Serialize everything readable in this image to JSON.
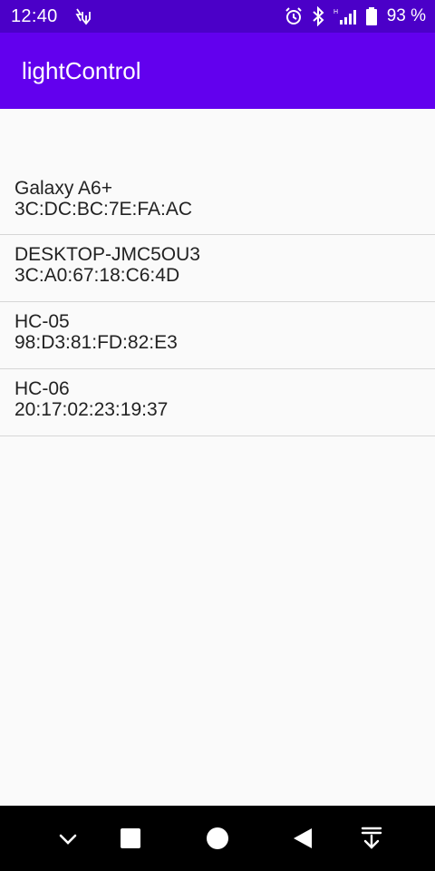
{
  "status_bar": {
    "time": "12:40",
    "battery": "93 %",
    "icons": [
      "usb-debug-icon",
      "alarm-icon",
      "bluetooth-icon",
      "signal-icon",
      "battery-icon"
    ]
  },
  "app_bar": {
    "title": "lightControl"
  },
  "devices": [
    {
      "name": "Galaxy A6+",
      "mac": "3C:DC:BC:7E:FA:AC"
    },
    {
      "name": "DESKTOP-JMC5OU3",
      "mac": "3C:A0:67:18:C6:4D"
    },
    {
      "name": "HC-05",
      "mac": "98:D3:81:FD:82:E3"
    },
    {
      "name": "HC-06",
      "mac": "20:17:02:23:19:37"
    }
  ],
  "nav_bar": {
    "buttons": [
      "collapse-icon",
      "recents-icon",
      "home-icon",
      "back-icon",
      "notification-pull-icon"
    ]
  },
  "colors": {
    "status_bar": "#4b00c8",
    "app_bar": "#6200ee",
    "background": "#fafafa",
    "divider": "#d6d6d6"
  }
}
